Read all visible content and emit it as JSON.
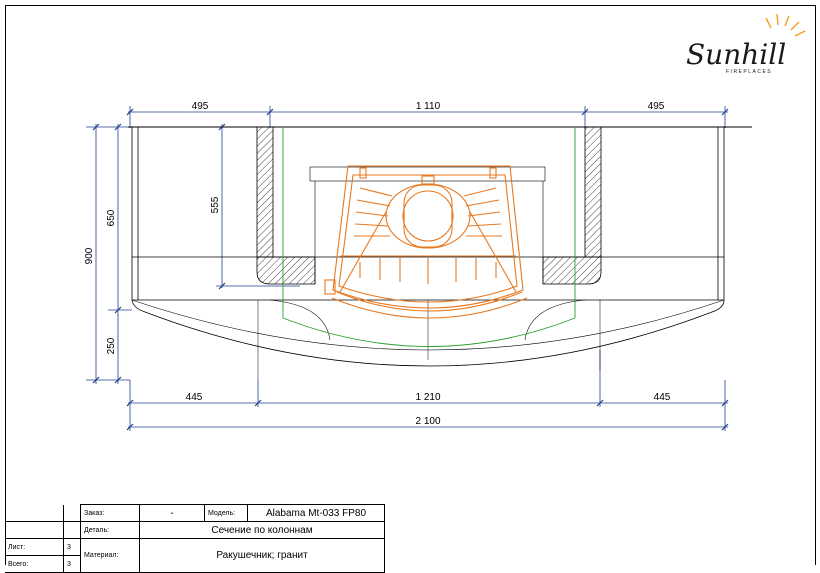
{
  "logo": {
    "brand": "Sunhill",
    "tagline": "FIREPLACES"
  },
  "dimensions": {
    "top_left": "495",
    "top_center": "1 110",
    "top_right": "495",
    "bottom_left": "445",
    "bottom_center": "1 210",
    "bottom_right": "445",
    "overall": "2 100",
    "height_total": "900",
    "height_upper": "650",
    "height_lower": "250",
    "height_inner": "555"
  },
  "stamp": {
    "order_label": "Заказ:",
    "order_value": "-",
    "model_label": "Модель:",
    "model_value": "Alabama Mt-033 FP80",
    "detail_label": "Деталь:",
    "detail_value": "Сечение по колоннам",
    "sheet_label": "Лист:",
    "sheet_value": "3",
    "total_label": "Всего:",
    "total_value": "3",
    "material_label": "Материал:",
    "material_value": "Ракушечник; гранит"
  },
  "colors": {
    "line": "#000000",
    "dimension": "#1f3f8f",
    "firebox": "#e8781e",
    "clearance": "#2aa02a",
    "logo": "#1a1a1a",
    "logo_sun": "#f0a020"
  }
}
